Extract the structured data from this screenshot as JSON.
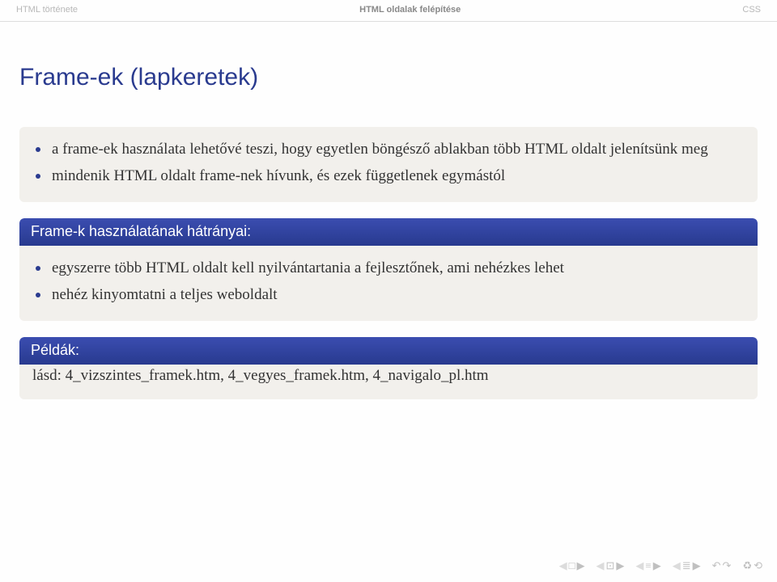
{
  "nav": {
    "left": "HTML története",
    "center": "HTML oldalak felépítése",
    "right": "CSS"
  },
  "title": "Frame-ek (lapkeretek)",
  "block1": {
    "items": [
      "a frame-ek használata lehetővé teszi, hogy egyetlen böngésző ablakban több HTML oldalt jelenítsünk meg",
      "mindenik HTML oldalt frame-nek hívunk, és ezek függetlenek egymástól"
    ]
  },
  "block2": {
    "header": "Frame-k használatának hátrányai:",
    "items": [
      "egyszerre több HTML oldalt kell nyilvántartania a fejlesztőnek, ami nehézkes lehet",
      "nehéz kinyomtatni a teljes weboldalt"
    ]
  },
  "block3": {
    "header": "Példák:",
    "text": "lásd: 4_vizszintes_framek.htm, 4_vegyes_framek.htm, 4_navigalo_pl.htm"
  },
  "footer": {
    "sec_prev": "◀",
    "sec_next": "▶",
    "sub_prev": "◀",
    "sub_next": "▶",
    "slide_prev": "◀",
    "slide_next": "▶",
    "frame_prev": "◀",
    "frame_next": "▶",
    "back": "↶",
    "forward": "↷",
    "box": "□",
    "recycle1": "♻",
    "recycle2": "⟲",
    "sec_icon": "□",
    "sub_icon": "⊡",
    "slide_icon": "≡",
    "frame_icon": "≣"
  }
}
